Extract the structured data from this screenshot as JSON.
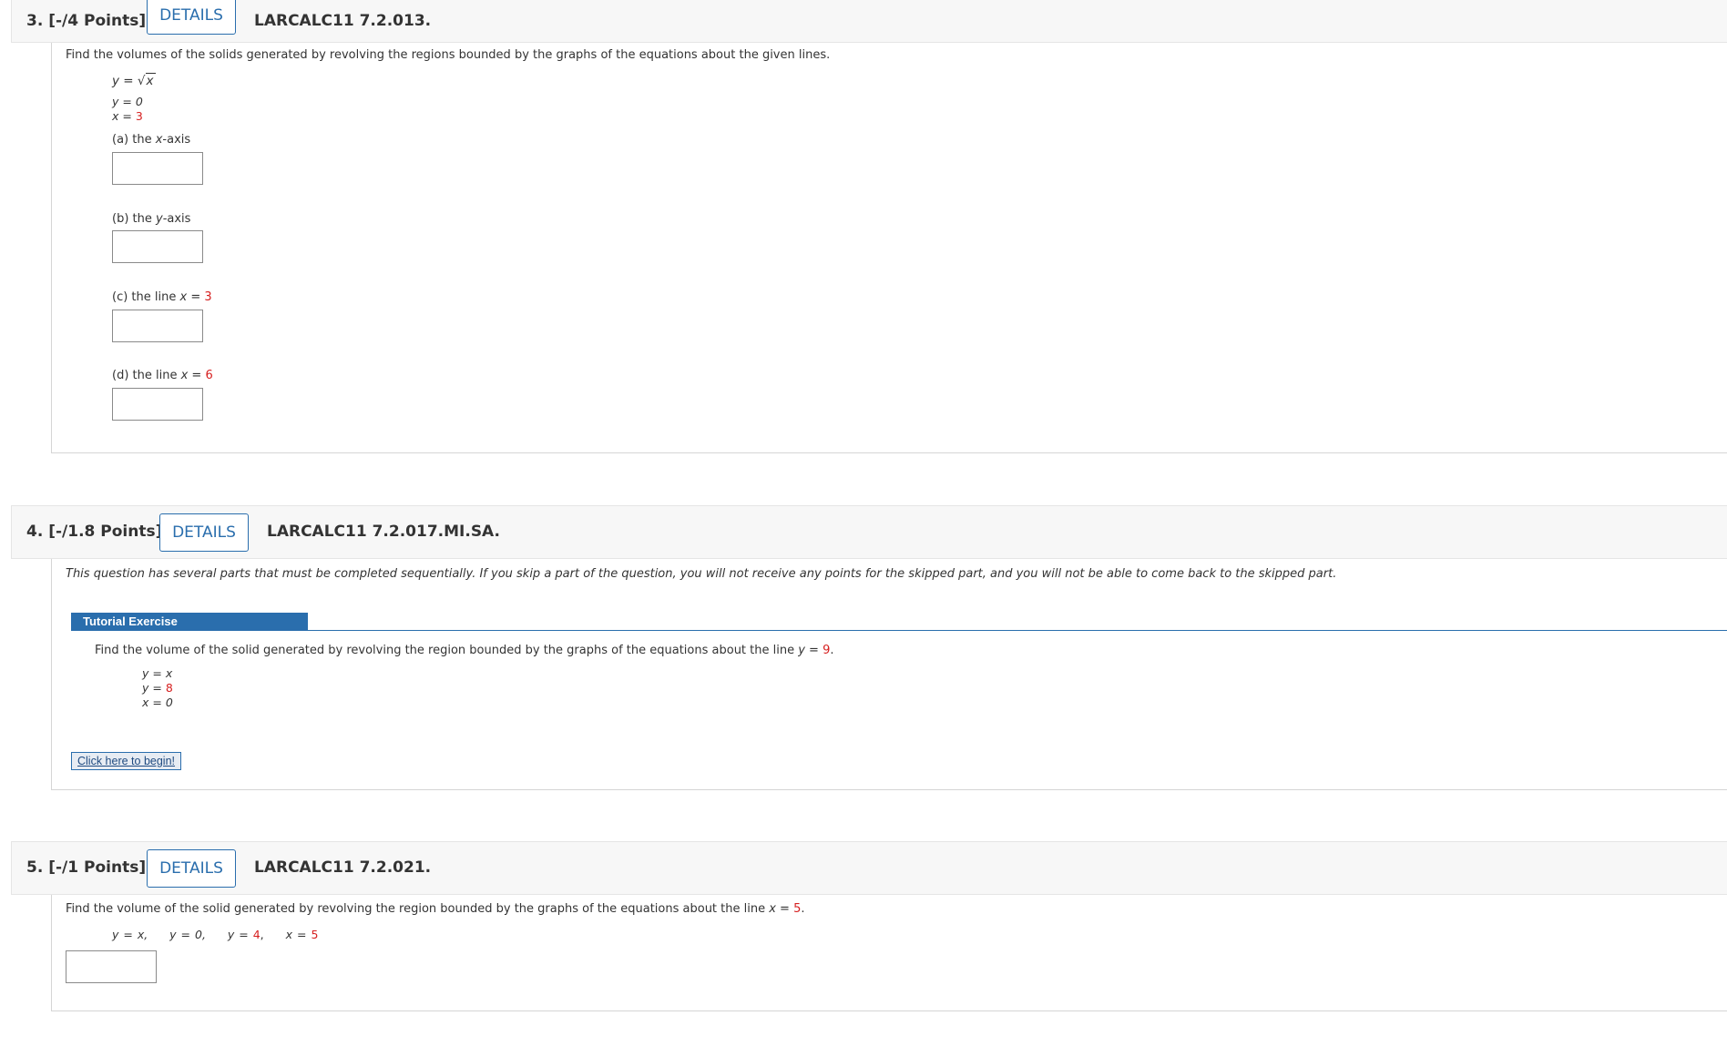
{
  "q3": {
    "number": "3.",
    "points": "[-/4 Points]",
    "details_label": "DETAILS",
    "code": "LARCALC11 7.2.013.",
    "prompt": "Find the volumes of the solids generated by revolving the regions bounded by the graphs of the equations about the given lines.",
    "equations": {
      "eq1_lhs": "y",
      "eq1_eq": " = ",
      "eq1_rad": "x",
      "eq2": "y = 0",
      "eq3_lhs": "x = ",
      "eq3_val": "3"
    },
    "parts": {
      "a_prefix": "(a) the ",
      "a_var": "x",
      "a_suffix": "-axis",
      "b_prefix": "(b) the ",
      "b_var": "y",
      "b_suffix": "-axis",
      "c_prefix": "(c) the line ",
      "c_var": "x",
      "c_eq": " = ",
      "c_val": "3",
      "d_prefix": "(d) the line ",
      "d_var": "x",
      "d_eq": " = ",
      "d_val": "6"
    }
  },
  "q4": {
    "number": "4.",
    "points": "[-/1.8 Points]",
    "details_label": "DETAILS",
    "code": "LARCALC11 7.2.017.MI.SA.",
    "note": "This question has several parts that must be completed sequentially. If you skip a part of the question, you will not receive any points for the skipped part, and you will not be able to come back to the skipped part.",
    "tutorial_title": "Tutorial Exercise",
    "prompt_prefix": "Find the volume of the solid generated by revolving the region bounded by the graphs of the equations about the line ",
    "prompt_var": "y",
    "prompt_eq": " = ",
    "prompt_val": "9",
    "prompt_end": ".",
    "eq1": "y = x",
    "eq2_lhs": "y = ",
    "eq2_val": "8",
    "eq3": "x = 0",
    "begin_label": "Click here to begin!"
  },
  "q5": {
    "number": "5.",
    "points": "[-/1 Points]",
    "details_label": "DETAILS",
    "code": "LARCALC11 7.2.021.",
    "prompt_prefix": "Find the volume of the solid generated by revolving the region bounded by the graphs of the equations about the line ",
    "prompt_var": "x",
    "prompt_eq": " = ",
    "prompt_val": "5",
    "prompt_end": ".",
    "eq_a": "y = x,",
    "eq_b": "y = 0,",
    "eq_c_lhs": "y = ",
    "eq_c_val": "4",
    "eq_c_comma": ",",
    "eq_d_lhs": "x = ",
    "eq_d_val": "5"
  },
  "colors": {
    "accent": "#2a6ead",
    "given_value": "#d61f1f",
    "header_bg": "#f7f7f7"
  }
}
